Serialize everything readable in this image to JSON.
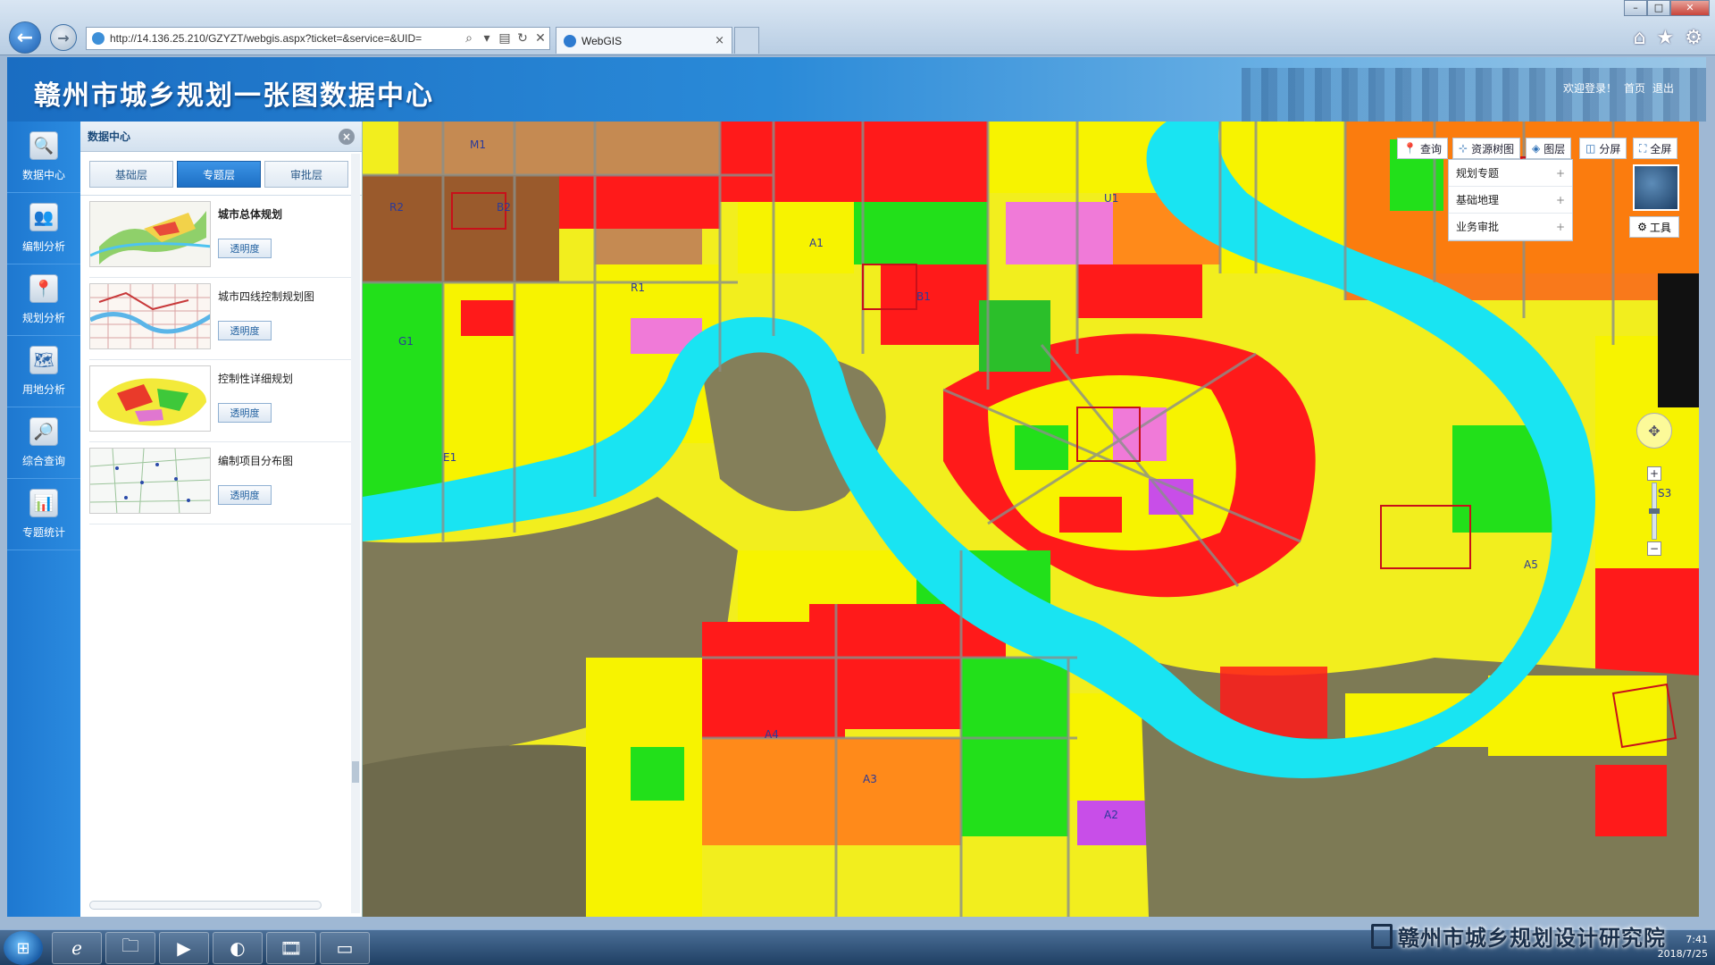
{
  "browser": {
    "url": "http://14.136.25.210/GZYZT/webgis.aspx?ticket=&service=&UID=",
    "tab_title": "WebGIS",
    "tab_close": "×",
    "back": "←",
    "forward": "→"
  },
  "header": {
    "title": "赣州市城乡规划一张图数据中心",
    "welcome": "欢迎登录！",
    "home": "首页",
    "logout": "退出"
  },
  "left_nav": {
    "items": [
      {
        "label": "数据中心",
        "icon": "🔍"
      },
      {
        "label": "编制分析",
        "icon": "👥"
      },
      {
        "label": "规划分析",
        "icon": "📍"
      },
      {
        "label": "用地分析",
        "icon": "🗺"
      },
      {
        "label": "综合查询",
        "icon": "🔎"
      },
      {
        "label": "专题统计",
        "icon": "📊"
      }
    ]
  },
  "data_panel": {
    "title": "数据中心",
    "close": "×",
    "tabs": [
      {
        "label": "基础层"
      },
      {
        "label": "专题层"
      },
      {
        "label": "审批层"
      }
    ],
    "maps": [
      {
        "title": "城市总体规划",
        "button": "透明度"
      },
      {
        "title": "城市四线控制规划图",
        "button": "透明度"
      },
      {
        "title": "控制性详细规划",
        "button": "透明度"
      },
      {
        "title": "编制项目分布图",
        "button": "透明度"
      }
    ]
  },
  "map_toolbar": {
    "query": "查询",
    "resource_tree": "资源树图",
    "layers": "图层",
    "split": "分屏",
    "fullscreen": "全屏",
    "tools": "工具",
    "dropdown": [
      {
        "label": "规划专题",
        "plus": "+"
      },
      {
        "label": "基础地理",
        "plus": "+"
      },
      {
        "label": "业务审批",
        "plus": "+"
      }
    ],
    "zoom_in": "+",
    "zoom_out": "−"
  },
  "map_labels": [
    "R2",
    "B2",
    "G1",
    "R1",
    "A1",
    "M1",
    "B1",
    "E1",
    "A5",
    "A4",
    "A3",
    "S3",
    "A2",
    "U1"
  ],
  "colors": {
    "river": "#19e4f2",
    "residential": "#f7f300",
    "commercial": "#ff1a1a",
    "green": "#22e01a",
    "industrial": "#c58a52",
    "public": "#f07ad8",
    "education": "#ff8a1a",
    "accent": "#1d6fc4"
  },
  "taskbar": {
    "watermark": "赣州市城乡规划设计研究院",
    "time": "7:41",
    "date": "2018/7/25"
  }
}
